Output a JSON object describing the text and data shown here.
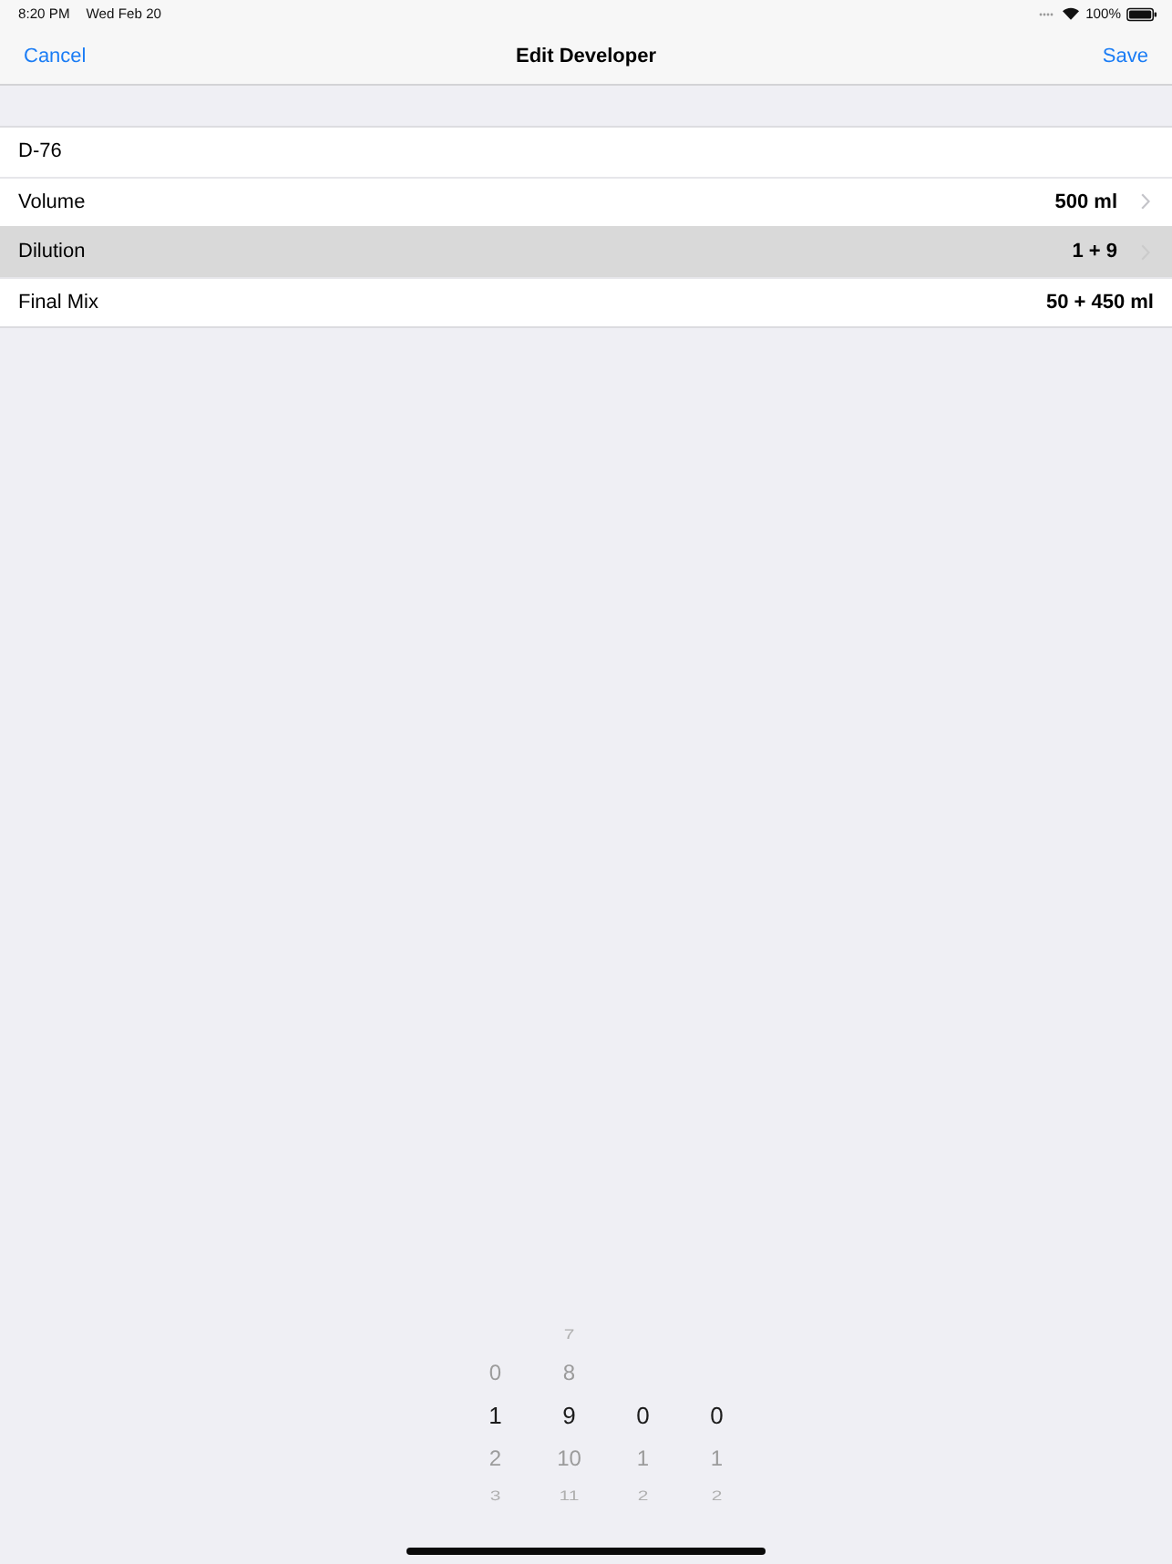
{
  "status_bar": {
    "time": "8:20 PM",
    "date": "Wed Feb 20",
    "battery_text": "100%"
  },
  "nav_bar": {
    "left_button": "Cancel",
    "title": "Edit Developer",
    "right_button": "Save"
  },
  "form": {
    "rows": [
      {
        "kind": "field",
        "value": "D-76",
        "selected": false
      },
      {
        "kind": "disclosure",
        "label": "Volume",
        "value": "500 ml",
        "selected": false
      },
      {
        "kind": "disclosure",
        "label": "Dilution",
        "value": "1 + 9",
        "selected": true
      },
      {
        "kind": "value",
        "label": "Final Mix",
        "value": "50 + 450 ml",
        "selected": false
      }
    ]
  },
  "picker": {
    "columns": [
      {
        "items": [
          {
            "label": "0",
            "selected": false
          },
          {
            "label": "1",
            "selected": true
          },
          {
            "label": "2",
            "selected": false
          },
          {
            "label": "3",
            "selected": false
          }
        ]
      },
      {
        "items": [
          {
            "label": "7",
            "selected": false
          },
          {
            "label": "8",
            "selected": false
          },
          {
            "label": "9",
            "selected": true
          },
          {
            "label": "10",
            "selected": false
          },
          {
            "label": "11",
            "selected": false
          }
        ]
      },
      {
        "items": [
          {
            "label": "0",
            "selected": true
          },
          {
            "label": "1",
            "selected": false
          },
          {
            "label": "2",
            "selected": false
          }
        ]
      },
      {
        "items": [
          {
            "label": "0",
            "selected": true
          },
          {
            "label": "1",
            "selected": false
          },
          {
            "label": "2",
            "selected": false
          }
        ]
      }
    ]
  }
}
